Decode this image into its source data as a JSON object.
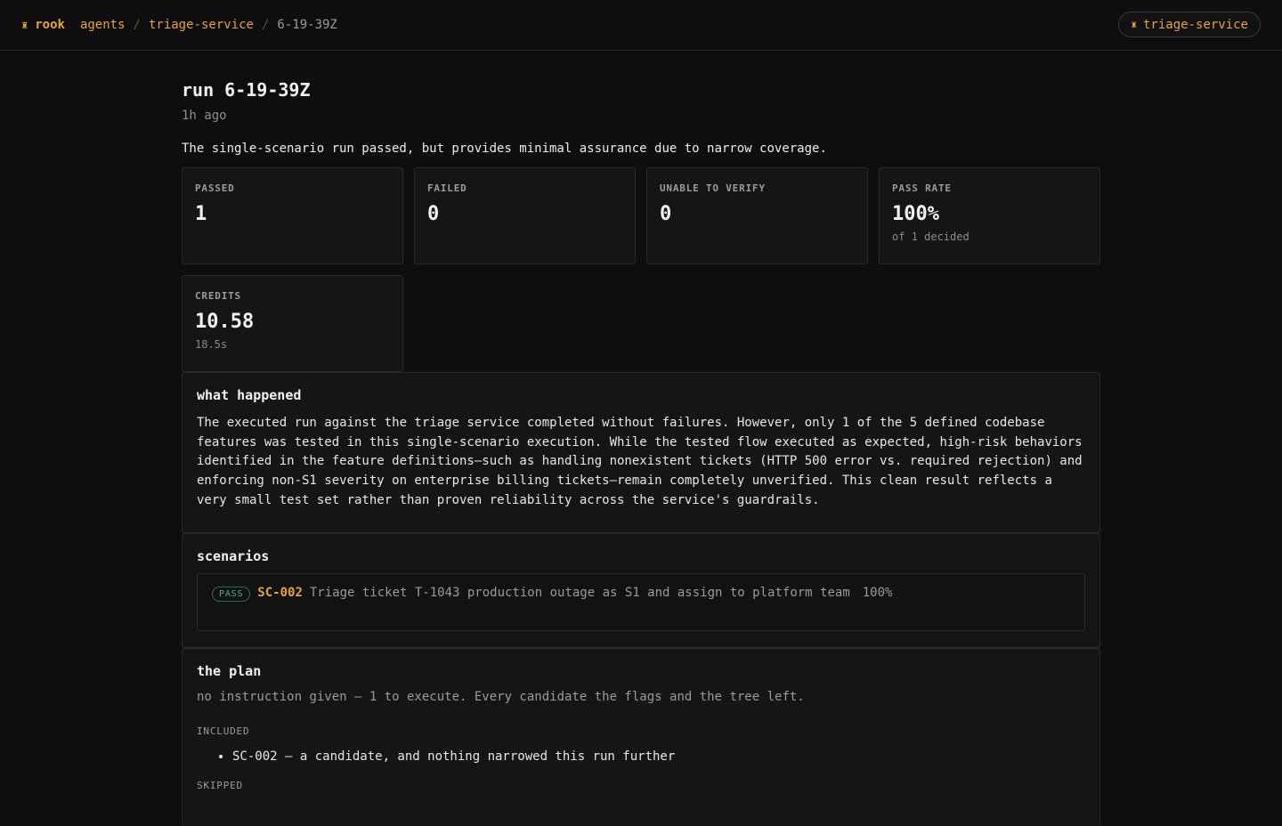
{
  "nav": {
    "brand": "rook",
    "breadcrumbs": [
      "agents",
      "triage-service"
    ],
    "current": "6-19-39Z",
    "separator": "/",
    "pill_label": "triage-service"
  },
  "run": {
    "title": "run 6-19-39Z",
    "age": "1h ago",
    "summary": "The single-scenario run passed, but provides minimal assurance due to narrow coverage."
  },
  "stats": [
    {
      "label": "PASSED",
      "value": "1",
      "sub": ""
    },
    {
      "label": "FAILED",
      "value": "0",
      "sub": ""
    },
    {
      "label": "UNABLE TO VERIFY",
      "value": "0",
      "sub": ""
    },
    {
      "label": "PASS RATE",
      "value": "100%",
      "sub": "of 1 decided"
    },
    {
      "label": "CREDITS",
      "value": "10.58",
      "sub": "18.5s"
    }
  ],
  "what_happened": {
    "heading": "what happened",
    "body": "The executed run against the triage service completed without failures. However, only 1 of the 5 defined codebase features was tested in this single-scenario execution. While the tested flow executed as expected, high-risk behaviors identified in the feature definitions—such as handling nonexistent tickets (HTTP 500 error vs. required rejection) and enforcing non-S1 severity on enterprise billing tickets—remain completely unverified. This clean result reflects a very small test set rather than proven reliability across the service's guardrails."
  },
  "scenarios": {
    "heading": "scenarios",
    "items": [
      {
        "status": "PASS",
        "id": "SC-002",
        "text": "Triage ticket T-1043 production outage as S1 and assign to platform team",
        "pct": "100%"
      }
    ]
  },
  "plan": {
    "heading": "the plan",
    "description": "no instruction given — 1 to execute. Every candidate the flags and the tree left.",
    "included_label": "INCLUDED",
    "included": [
      "SC-002 — a candidate, and nothing narrowed this run further"
    ],
    "skipped_label": "SKIPPED"
  },
  "icons": {
    "brand": "rook-icon"
  },
  "colors": {
    "accent": "#e9a23b",
    "pass": "#52b07a",
    "background": "#0e0e10"
  }
}
